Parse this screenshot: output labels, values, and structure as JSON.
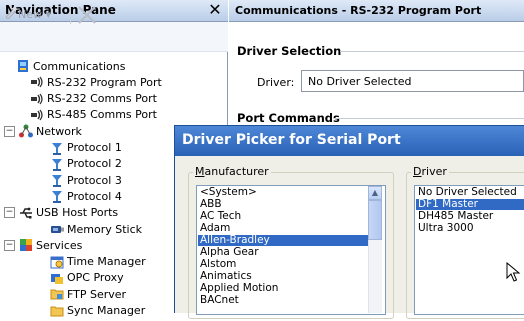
{
  "nav": {
    "title": "Navigation Pane",
    "close_glyph": "✕",
    "toolbar": {
      "new_label": "New",
      "new_arrow": "▾"
    },
    "tree": [
      {
        "label": "Communications",
        "icon": "communications-icon",
        "indent": 0,
        "expander": ""
      },
      {
        "label": "RS-232 Program Port",
        "icon": "serial-port-icon",
        "indent": 1,
        "expander": ""
      },
      {
        "label": "RS-232 Comms Port",
        "icon": "serial-port-icon",
        "indent": 1,
        "expander": ""
      },
      {
        "label": "RS-485 Comms Port",
        "icon": "serial-port-icon",
        "indent": 1,
        "expander": ""
      },
      {
        "label": "Network",
        "icon": "network-icon",
        "indent": 0,
        "expander": "−"
      },
      {
        "label": "Protocol 1",
        "icon": "protocol-icon",
        "indent": 2,
        "expander": ""
      },
      {
        "label": "Protocol 2",
        "icon": "protocol-icon",
        "indent": 2,
        "expander": ""
      },
      {
        "label": "Protocol 3",
        "icon": "protocol-icon",
        "indent": 2,
        "expander": ""
      },
      {
        "label": "Protocol 4",
        "icon": "protocol-icon",
        "indent": 2,
        "expander": ""
      },
      {
        "label": "USB Host Ports",
        "icon": "usb-icon",
        "indent": 0,
        "expander": "−"
      },
      {
        "label": "Memory Stick",
        "icon": "memory-stick-icon",
        "indent": 2,
        "expander": ""
      },
      {
        "label": "Services",
        "icon": "services-icon",
        "indent": 0,
        "expander": "−"
      },
      {
        "label": "Time Manager",
        "icon": "time-manager-icon",
        "indent": 2,
        "expander": ""
      },
      {
        "label": "OPC Proxy",
        "icon": "opc-proxy-icon",
        "indent": 2,
        "expander": ""
      },
      {
        "label": "FTP Server",
        "icon": "ftp-server-icon",
        "indent": 2,
        "expander": ""
      },
      {
        "label": "Sync Manager",
        "icon": "sync-manager-icon",
        "indent": 2,
        "expander": ""
      }
    ]
  },
  "main": {
    "title": "Communications - RS-232 Program Port",
    "driver_selection_title": "Driver Selection",
    "driver_label": "Driver:",
    "driver_value": "No Driver Selected",
    "port_commands_title": "Port Commands"
  },
  "dialog": {
    "title": "Driver Picker for Serial Port",
    "manufacturer_label_underlined": "M",
    "manufacturer_label_rest": "anufacturer",
    "driver_label_underlined": "D",
    "driver_label_rest": "river",
    "manufacturers": [
      "<System>",
      "ABB",
      "AC Tech",
      "Adam",
      "Allen-Bradley",
      "Alpha Gear",
      "Alstom",
      "Animatics",
      "Applied Motion",
      "BACnet"
    ],
    "manufacturer_selected_index": 4,
    "drivers": [
      "No Driver Selected",
      "DF1 Master",
      "DH485 Master",
      "Ultra 3000"
    ],
    "driver_selected_index": 1
  },
  "colors": {
    "selection": "#316ac5",
    "dialog_title_bar": "#2a62b7",
    "pane_header": "#b9cde8"
  }
}
